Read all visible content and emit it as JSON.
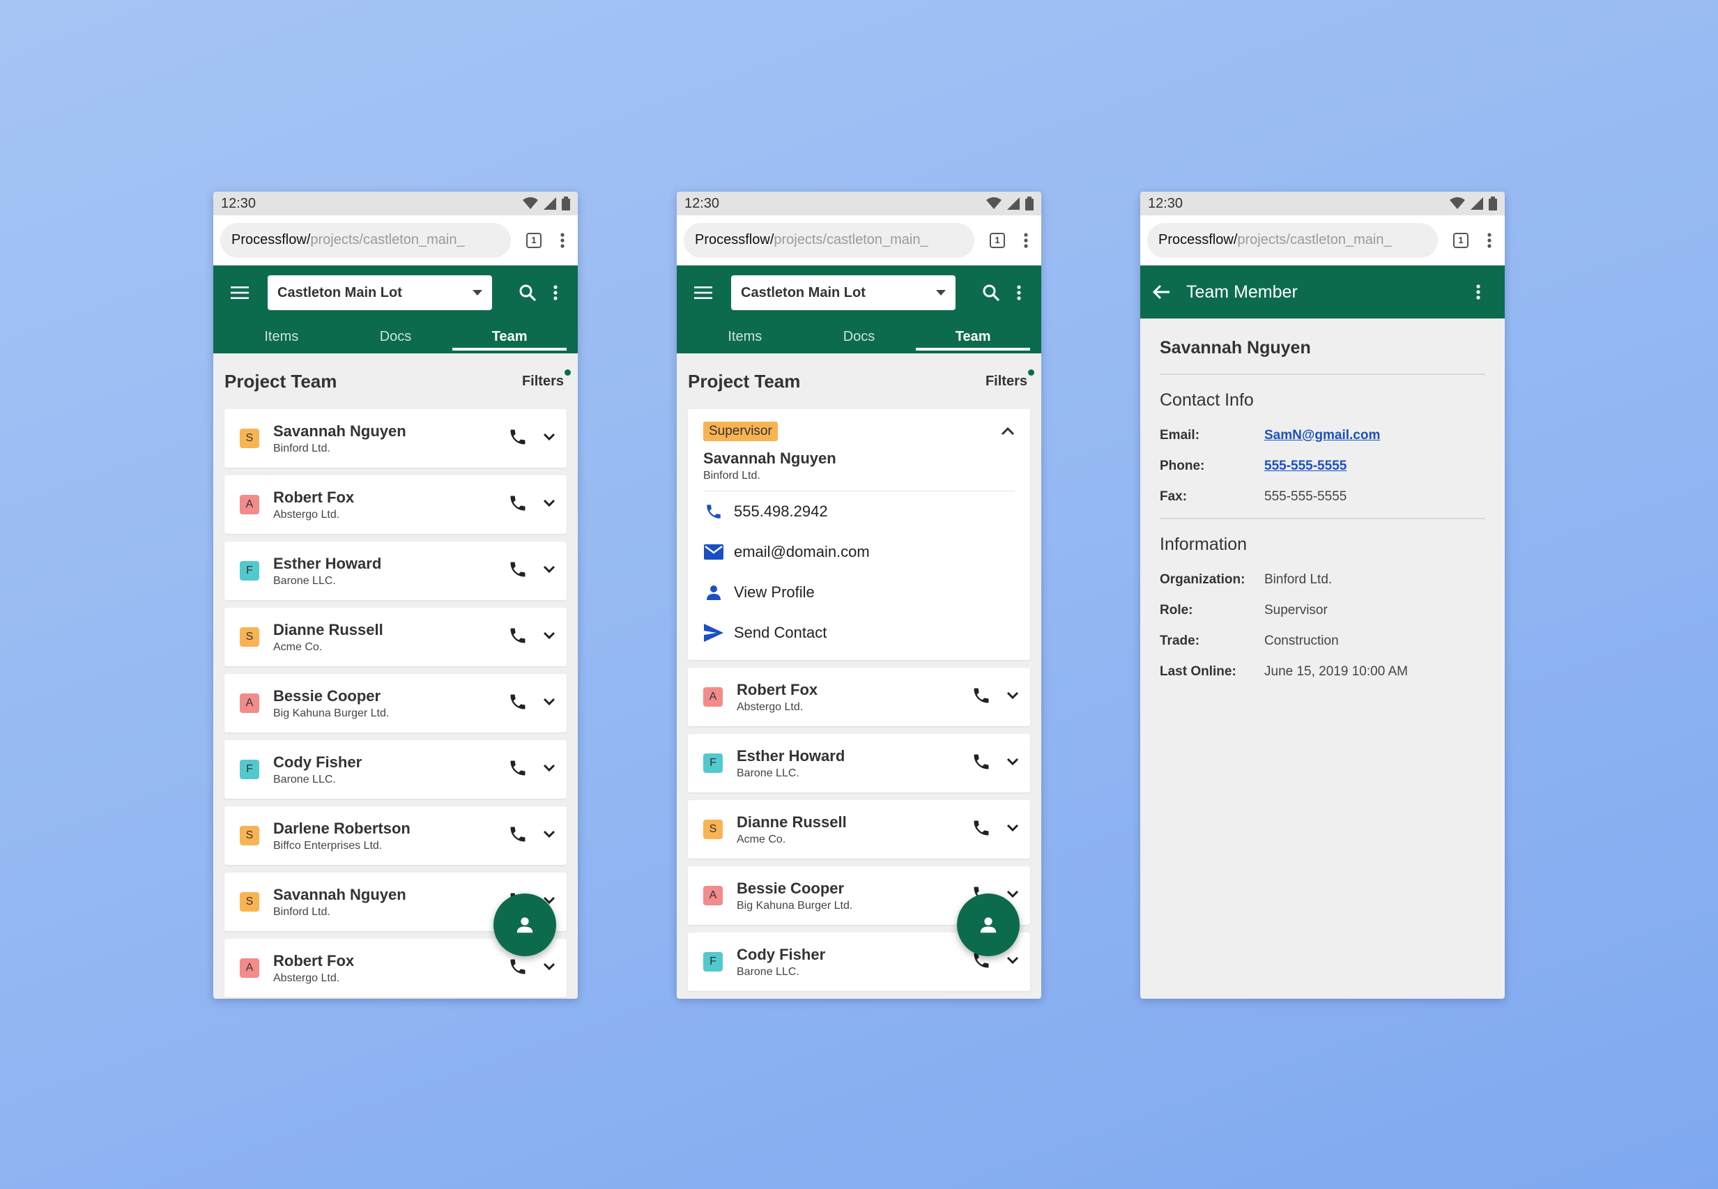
{
  "status": {
    "time": "12:30"
  },
  "browser": {
    "host": "Processflow/",
    "path": "projects/castleton_main_",
    "tab_count": "1"
  },
  "project_select": "Castleton Main Lot",
  "tabs": [
    "Items",
    "Docs",
    "Team"
  ],
  "active_tab": "Team",
  "section_title": "Project Team",
  "filters_label": "Filters",
  "colors": {
    "brand": "#0c6b4d",
    "badge_S": "#f8b452",
    "badge_A": "#f28b8b",
    "badge_F": "#52c9cd",
    "link": "#1a4fc4"
  },
  "team_list": [
    {
      "initial": "S",
      "name": "Savannah Nguyen",
      "org": "Binford Ltd."
    },
    {
      "initial": "A",
      "name": "Robert Fox",
      "org": "Abstergo Ltd."
    },
    {
      "initial": "F",
      "name": "Esther Howard",
      "org": "Barone LLC."
    },
    {
      "initial": "S",
      "name": "Dianne Russell",
      "org": "Acme Co."
    },
    {
      "initial": "A",
      "name": "Bessie Cooper",
      "org": "Big Kahuna Burger Ltd."
    },
    {
      "initial": "F",
      "name": "Cody Fisher",
      "org": "Barone LLC."
    },
    {
      "initial": "S",
      "name": "Darlene Robertson",
      "org": "Biffco Enterprises Ltd."
    },
    {
      "initial": "S",
      "name": "Savannah Nguyen",
      "org": "Binford Ltd."
    },
    {
      "initial": "A",
      "name": "Robert Fox",
      "org": "Abstergo Ltd."
    }
  ],
  "expanded": {
    "role": "Supervisor",
    "name": "Savannah Nguyen",
    "org": "Binford Ltd.",
    "actions": [
      {
        "icon": "phone-icon",
        "label": "555.498.2942"
      },
      {
        "icon": "mail-icon",
        "label": "email@domain.com"
      },
      {
        "icon": "person-icon",
        "label": "View Profile"
      },
      {
        "icon": "send-icon",
        "label": "Send Contact"
      }
    ]
  },
  "team_list_after": [
    {
      "initial": "A",
      "name": "Robert Fox",
      "org": "Abstergo Ltd."
    },
    {
      "initial": "F",
      "name": "Esther Howard",
      "org": "Barone LLC."
    },
    {
      "initial": "S",
      "name": "Dianne Russell",
      "org": "Acme Co."
    },
    {
      "initial": "A",
      "name": "Bessie Cooper",
      "org": "Big Kahuna Burger Ltd."
    },
    {
      "initial": "F",
      "name": "Cody Fisher",
      "org": "Barone LLC."
    }
  ],
  "member_detail": {
    "title": "Team Member",
    "name": "Savannah Nguyen",
    "contact_heading": "Contact Info",
    "contact": [
      {
        "label": "Email:",
        "value": "SamN@gmail.com",
        "link": true
      },
      {
        "label": "Phone:",
        "value": "555-555-5555",
        "link": true
      },
      {
        "label": "Fax:",
        "value": "555-555-5555",
        "link": false
      }
    ],
    "info_heading": "Information",
    "info": [
      {
        "label": "Organization:",
        "value": "Binford Ltd."
      },
      {
        "label": "Role:",
        "value": "Supervisor"
      },
      {
        "label": "Trade:",
        "value": "Construction"
      },
      {
        "label": "Last Online:",
        "value": "June 15, 2019 10:00 AM"
      }
    ]
  }
}
